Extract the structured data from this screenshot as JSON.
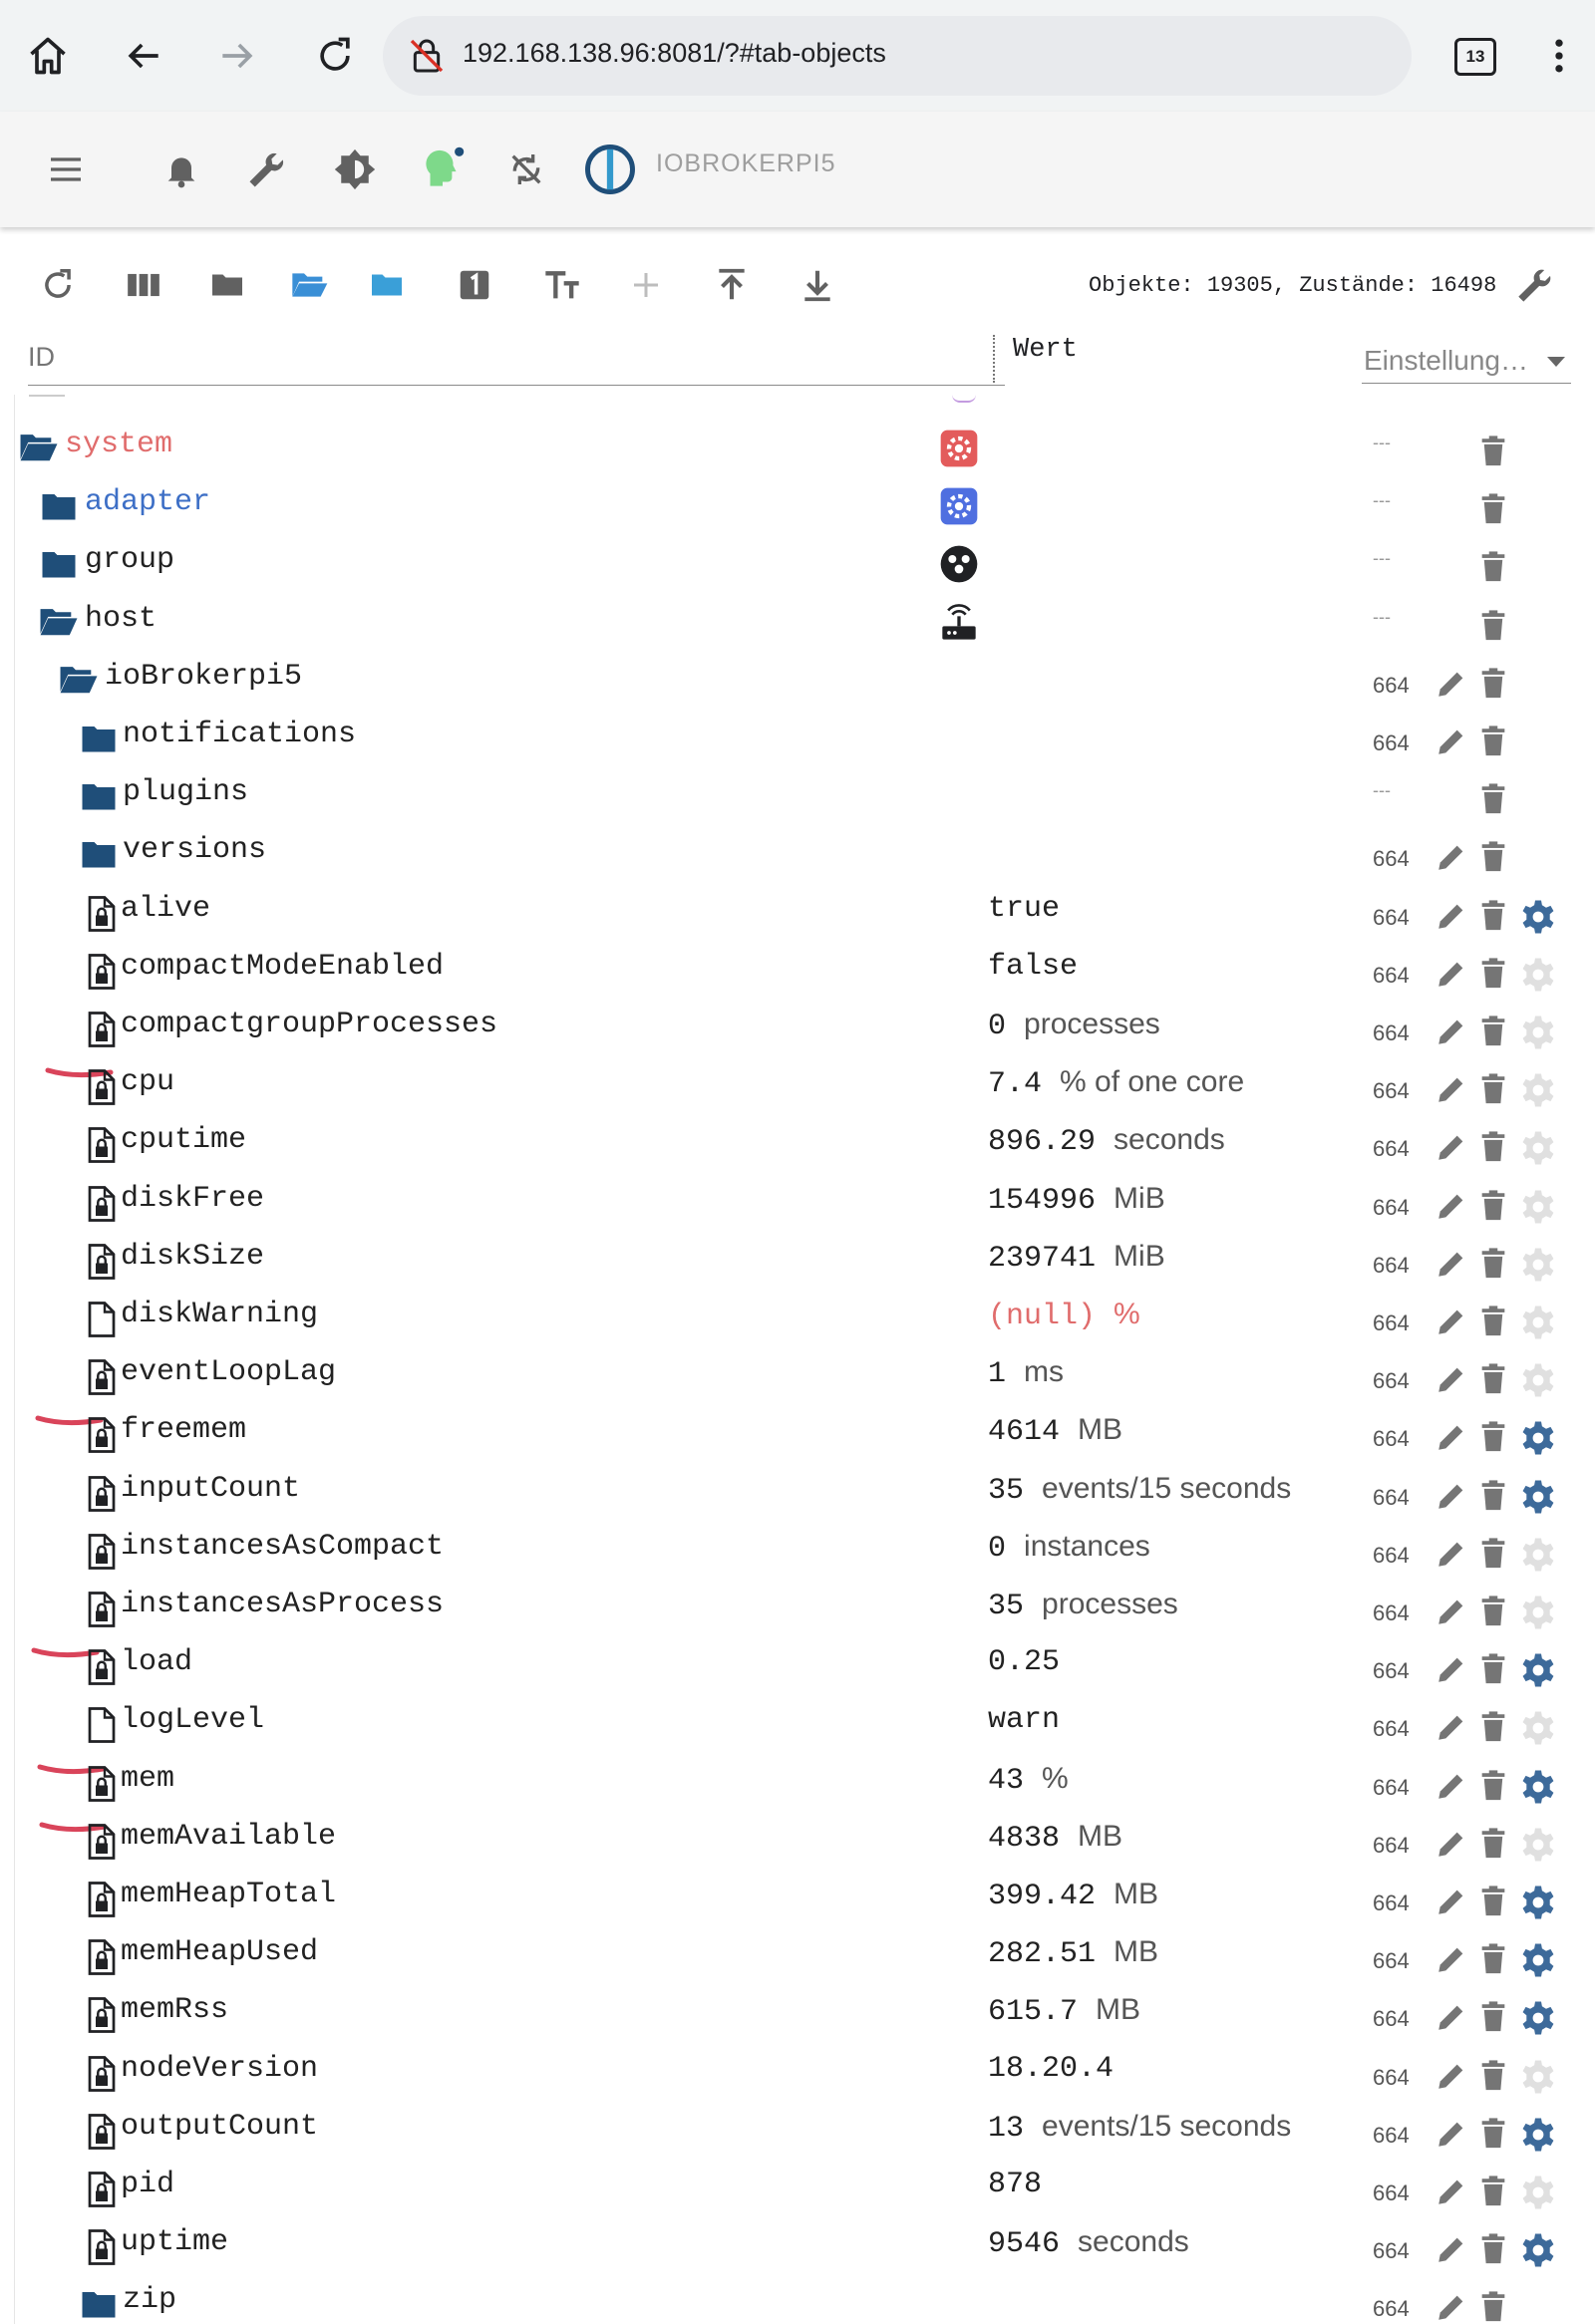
{
  "browser": {
    "url": "192.168.138.96:8081/?#tab-objects",
    "tab_count": "13"
  },
  "app": {
    "hostname": "IOBROKERPI5"
  },
  "toolbar": {
    "counts": "Objekte: 19305, Zustände: 16498"
  },
  "filter": {
    "id_placeholder": "ID",
    "value_header": "Wert",
    "settings_label": "Einstellung…"
  },
  "colors": {
    "folder": "#1f4e79",
    "system_text": "#e06c6c",
    "adapter_text": "#3d6fc6",
    "toolbar_active": "#3a8fd6",
    "config_active": "#3d6a9a",
    "config_inactive": "#e0e0e0",
    "annotation": "#d9445a"
  },
  "tree": {
    "rows": [
      {
        "name": "system",
        "acl": "---"
      },
      {
        "name": "adapter",
        "acl": "---"
      },
      {
        "name": "group",
        "acl": "---"
      },
      {
        "name": "host",
        "acl": "---"
      },
      {
        "name": "ioBrokerpi5",
        "acl": "664"
      },
      {
        "name": "notifications",
        "acl": "664"
      },
      {
        "name": "plugins",
        "acl": "---"
      },
      {
        "name": "versions",
        "acl": "664"
      },
      {
        "name": "alive",
        "value": "true",
        "unit": "",
        "acl": "664",
        "config_active": true
      },
      {
        "name": "compactModeEnabled",
        "value": "false",
        "unit": "",
        "acl": "664",
        "config_active": false
      },
      {
        "name": "compactgroupProcesses",
        "value": "0",
        "unit": "processes",
        "acl": "664",
        "config_active": false
      },
      {
        "name": "cpu",
        "value": "7.4",
        "unit": "% of one core",
        "acl": "664",
        "config_active": false
      },
      {
        "name": "cputime",
        "value": "896.29",
        "unit": "seconds",
        "acl": "664",
        "config_active": false
      },
      {
        "name": "diskFree",
        "value": "154996",
        "unit": "MiB",
        "acl": "664",
        "config_active": false
      },
      {
        "name": "diskSize",
        "value": "239741",
        "unit": "MiB",
        "acl": "664",
        "config_active": false
      },
      {
        "name": "diskWarning",
        "value": "(null)",
        "unit": "%",
        "acl": "664",
        "config_active": false
      },
      {
        "name": "eventLoopLag",
        "value": "1",
        "unit": "ms",
        "acl": "664",
        "config_active": false
      },
      {
        "name": "freemem",
        "value": "4614",
        "unit": "MB",
        "acl": "664",
        "config_active": true
      },
      {
        "name": "inputCount",
        "value": "35",
        "unit": "events/15 seconds",
        "acl": "664",
        "config_active": true
      },
      {
        "name": "instancesAsCompact",
        "value": "0",
        "unit": "instances",
        "acl": "664",
        "config_active": false
      },
      {
        "name": "instancesAsProcess",
        "value": "35",
        "unit": "processes",
        "acl": "664",
        "config_active": false
      },
      {
        "name": "load",
        "value": "0.25",
        "unit": "",
        "acl": "664",
        "config_active": true
      },
      {
        "name": "logLevel",
        "value": "warn",
        "unit": "",
        "acl": "664",
        "config_active": false
      },
      {
        "name": "mem",
        "value": "43",
        "unit": "%",
        "acl": "664",
        "config_active": true
      },
      {
        "name": "memAvailable",
        "value": "4838",
        "unit": "MB",
        "acl": "664",
        "config_active": false
      },
      {
        "name": "memHeapTotal",
        "value": "399.42",
        "unit": "MB",
        "acl": "664",
        "config_active": true
      },
      {
        "name": "memHeapUsed",
        "value": "282.51",
        "unit": "MB",
        "acl": "664",
        "config_active": true
      },
      {
        "name": "memRss",
        "value": "615.7",
        "unit": "MB",
        "acl": "664",
        "config_active": true
      },
      {
        "name": "nodeVersion",
        "value": "18.20.4",
        "unit": "",
        "acl": "664",
        "config_active": false
      },
      {
        "name": "outputCount",
        "value": "13",
        "unit": "events/15 seconds",
        "acl": "664",
        "config_active": true
      },
      {
        "name": "pid",
        "value": "878",
        "unit": "",
        "acl": "664",
        "config_active": false
      },
      {
        "name": "uptime",
        "value": "9546",
        "unit": "seconds",
        "acl": "664",
        "config_active": true
      },
      {
        "name": "zip",
        "acl": "664"
      }
    ]
  }
}
